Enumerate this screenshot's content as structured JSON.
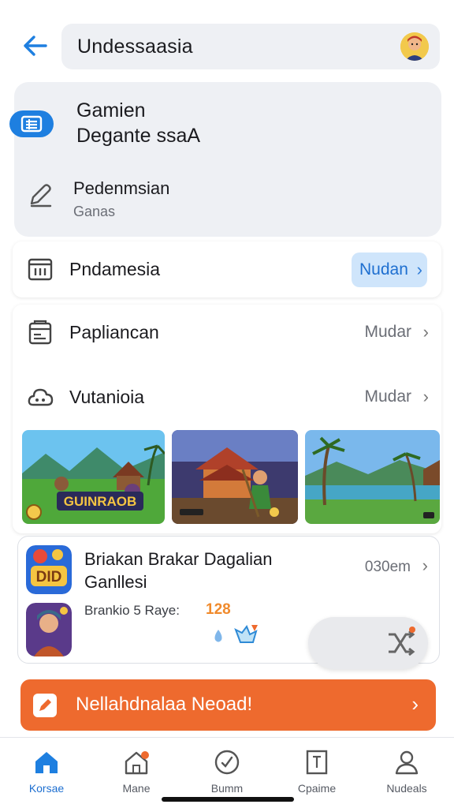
{
  "header": {
    "back_icon": "arrow-left-icon",
    "title": "Undessaasia",
    "avatar_icon": "user-avatar"
  },
  "profile": {
    "title_line1": "Gamien",
    "title_line2": "Degante ssaA",
    "list_icon": "list-icon",
    "sub_label": "Pedenmsian",
    "sub_desc": "Ganas",
    "sub_icon": "edit-icon"
  },
  "rows": [
    {
      "label": "Pndamesia",
      "value": "Nudan",
      "icon": "calendar-icon",
      "highlighted": true
    },
    {
      "label": "Papliancan",
      "value": "Mudar",
      "icon": "clipboard-icon",
      "highlighted": false
    },
    {
      "label": "Vutanioia",
      "value": "Mudar",
      "icon": "cloud-icon",
      "highlighted": false
    }
  ],
  "thumbnails": [
    {
      "caption": "GUINRAOB"
    },
    {
      "caption": ""
    },
    {
      "caption": ""
    }
  ],
  "activity": {
    "title_line1": "Briakan Brakar Dagalian",
    "title_line2": "Ganllesi",
    "time": "030em",
    "game_icon_text": "DID",
    "sub": "Brankio 5 Raye:",
    "score": "128"
  },
  "cta": {
    "label": "Nellahdnalaa Neoad!",
    "icon": "pencil-icon"
  },
  "nav": [
    {
      "label": "Korsae",
      "icon": "home-icon",
      "active": true
    },
    {
      "label": "Mane",
      "icon": "house-badge-icon",
      "active": false
    },
    {
      "label": "Bumm",
      "icon": "compass-icon",
      "active": false
    },
    {
      "label": "Cpaime",
      "icon": "document-icon",
      "active": false
    },
    {
      "label": "Nudeals",
      "icon": "person-icon",
      "active": false
    }
  ],
  "colors": {
    "accent": "#1e7fe0",
    "cta": "#ee6a2e",
    "score": "#f08a2c"
  }
}
